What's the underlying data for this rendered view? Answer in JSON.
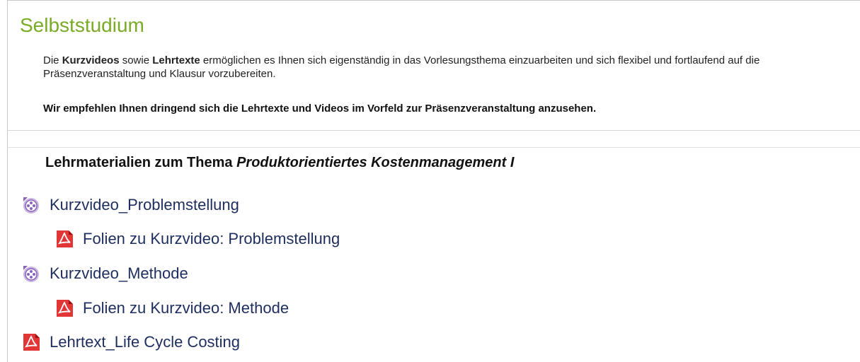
{
  "section": {
    "title": "Selbststudium"
  },
  "intro": {
    "p1_pre": "Die ",
    "p1_b1": "Kurzvideos",
    "p1_mid": " sowie ",
    "p1_b2": "Lehrtexte",
    "p1_post": " ermöglichen es Ihnen sich eigenständig in das Vorlesungsthema einzuarbeiten und sich flexibel und fortlaufend auf die Präsenzveranstaltung und Klausur vorzubereiten.",
    "p2": "Wir empfehlen Ihnen dringend sich die Lehrtexte und Videos im Vorfeld zur Präsenzveranstaltung anzusehen."
  },
  "materials": {
    "heading_prefix": "Lehrmaterialien zum Thema ",
    "heading_topic": "Produktorientiertes Kostenmanagement I",
    "items": [
      {
        "label": "Kurzvideo_Problemstellung",
        "icon": "video-icon"
      },
      {
        "label": "Folien zu Kurzvideo: Problemstellung",
        "icon": "pdf-icon"
      },
      {
        "label": "Kurzvideo_Methode",
        "icon": "video-icon"
      },
      {
        "label": "Folien zu Kurzvideo: Methode",
        "icon": "pdf-icon"
      },
      {
        "label": "Lehrtext_Life Cycle Costing",
        "icon": "pdf-icon"
      }
    ]
  },
  "colors": {
    "title": "#7aaa26",
    "link": "#1d2d5e",
    "pdf": "#d7191c",
    "video": "#7b5aa6"
  }
}
